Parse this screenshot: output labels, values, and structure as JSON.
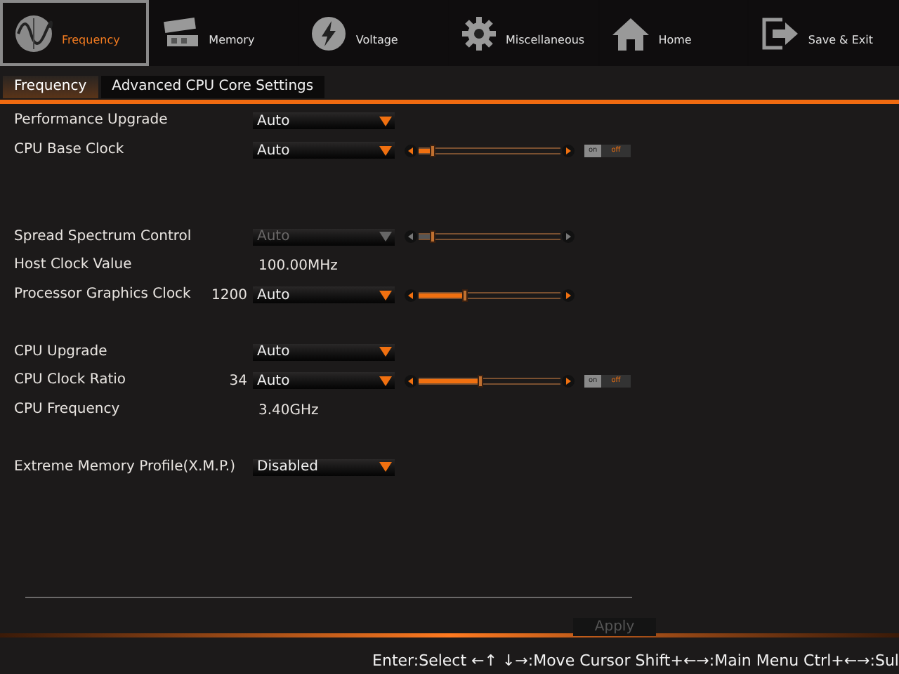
{
  "main_tabs": [
    {
      "label": "Frequency",
      "selected": true
    },
    {
      "label": "Memory",
      "selected": false
    },
    {
      "label": "Voltage",
      "selected": false
    },
    {
      "label": "Miscellaneous",
      "selected": false
    },
    {
      "label": "Home",
      "selected": false
    },
    {
      "label": "Save & Exit",
      "selected": false
    }
  ],
  "sub_tabs": [
    {
      "label": "Frequency",
      "selected": true
    },
    {
      "label": "Advanced CPU Core Settings",
      "selected": false
    }
  ],
  "groups": [
    {
      "rows": [
        {
          "label": "Performance Upgrade",
          "dropdown": {
            "value": "Auto",
            "disabled": false
          }
        },
        {
          "label": "CPU Base Clock",
          "dropdown": {
            "value": "Auto",
            "disabled": false
          },
          "slider": {
            "level": 0.1,
            "disabled": false
          },
          "toggle": {
            "on": false,
            "on_label": "on",
            "off_label": "off"
          }
        }
      ]
    },
    {
      "rows": [
        {
          "label": "Spread Spectrum Control",
          "dropdown": {
            "value": "Auto",
            "disabled": true
          },
          "slider": {
            "level": 0.1,
            "disabled": true
          }
        },
        {
          "label": "Host Clock Value",
          "value": "100.00MHz"
        },
        {
          "label": "Processor Graphics Clock",
          "number": "1200",
          "dropdown": {
            "value": "Auto",
            "disabled": false
          },
          "slider": {
            "level": 0.33,
            "disabled": false
          }
        }
      ]
    },
    {
      "rows": [
        {
          "label": "CPU Upgrade",
          "dropdown": {
            "value": "Auto",
            "disabled": false
          }
        },
        {
          "label": "CPU Clock Ratio",
          "number": "34",
          "dropdown": {
            "value": "Auto",
            "disabled": false
          },
          "slider": {
            "level": 0.44,
            "disabled": false
          },
          "toggle": {
            "on": false,
            "on_label": "on",
            "off_label": "off"
          }
        },
        {
          "label": "CPU Frequency",
          "value": "3.40GHz"
        }
      ]
    },
    {
      "rows": [
        {
          "label": "Extreme Memory Profile(X.M.P.)",
          "dropdown": {
            "value": "Disabled",
            "disabled": false
          }
        }
      ]
    }
  ],
  "apply_button": {
    "label": "Apply",
    "disabled": true
  },
  "footer_hint": "Enter:Select ←↑ ↓→:Move Cursor Shift+←→:Main Menu Ctrl+←→:Sul"
}
